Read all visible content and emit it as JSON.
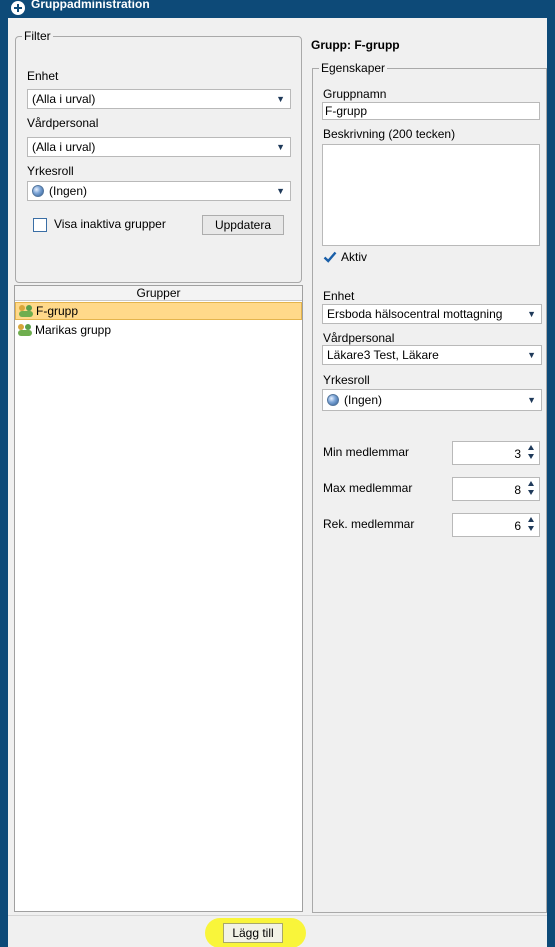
{
  "window": {
    "title": "Gruppadministration"
  },
  "filter": {
    "legend": "Filter",
    "unit_label": "Enhet",
    "unit_value": "(Alla i urval)",
    "staff_label": "Vårdpersonal",
    "staff_value": "(Alla i urval)",
    "role_label": "Yrkesroll",
    "role_value": "(Ingen)",
    "show_inactive_label": "Visa inaktiva grupper",
    "show_inactive_checked": false,
    "update_button": "Uppdatera"
  },
  "groups": {
    "header": "Grupper",
    "items": [
      {
        "name": "F-grupp",
        "selected": true
      },
      {
        "name": "Marikas grupp",
        "selected": false
      }
    ]
  },
  "details": {
    "group_title": "Grupp: F-grupp",
    "legend": "Egenskaper",
    "name_label": "Gruppnamn",
    "name_value": "F-grupp",
    "description_label": "Beskrivning (200 tecken)",
    "description_value": "",
    "active_label": "Aktiv",
    "active_checked": true,
    "unit_label": "Enhet",
    "unit_value": "Ersboda hälsocentral mottagning",
    "staff_label": "Vårdpersonal",
    "staff_value": "Läkare3 Test, Läkare",
    "role_label": "Yrkesroll",
    "role_value": "(Ingen)",
    "min_label": "Min medlemmar",
    "min_value": "3",
    "max_label": "Max medlemmar",
    "max_value": "8",
    "rec_label": "Rek. medlemmar",
    "rec_value": "6"
  },
  "footer": {
    "add_button": "Lägg till"
  },
  "colors": {
    "titlebar": "#0d4a78",
    "selection": "#ffd98a",
    "highlight": "#f9f53a",
    "check": "#1a5fa8"
  }
}
